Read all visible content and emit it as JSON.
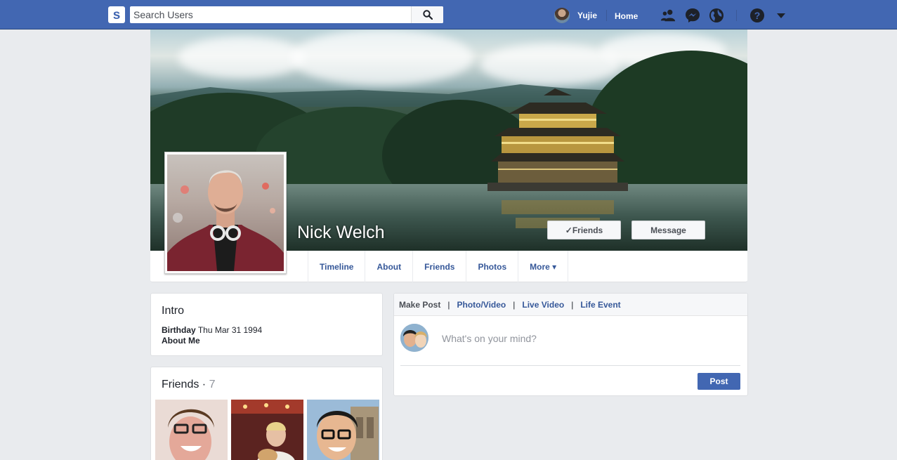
{
  "topbar": {
    "logo": "s",
    "search_placeholder": "Search Users",
    "user_name": "Yujie",
    "home_label": "Home"
  },
  "profile": {
    "name": "Nick Welch",
    "friends_button": "✓Friends",
    "message_button": "Message"
  },
  "tabs": [
    "Timeline",
    "About",
    "Friends",
    "Photos",
    "More ▾"
  ],
  "intro": {
    "title": "Intro",
    "birthday_label": "Birthday",
    "birthday_value": "Thu Mar 31 1994",
    "about_label": "About Me"
  },
  "friends": {
    "title": "Friends ·",
    "count": "7"
  },
  "composer": {
    "make_post": "Make Post",
    "sep": "|",
    "photo_video": "Photo/Video",
    "live_video": "Live Video",
    "life_event": "Life Event",
    "placeholder": "What's on your mind?",
    "post_button": "Post"
  },
  "colors": {
    "brand": "#4267b2",
    "link": "#365899",
    "background": "#e9ebee"
  },
  "icons": [
    "logo-icon",
    "search-icon",
    "friend-requests-icon",
    "messenger-icon",
    "notifications-globe-icon",
    "help-icon",
    "caret-down-icon"
  ]
}
